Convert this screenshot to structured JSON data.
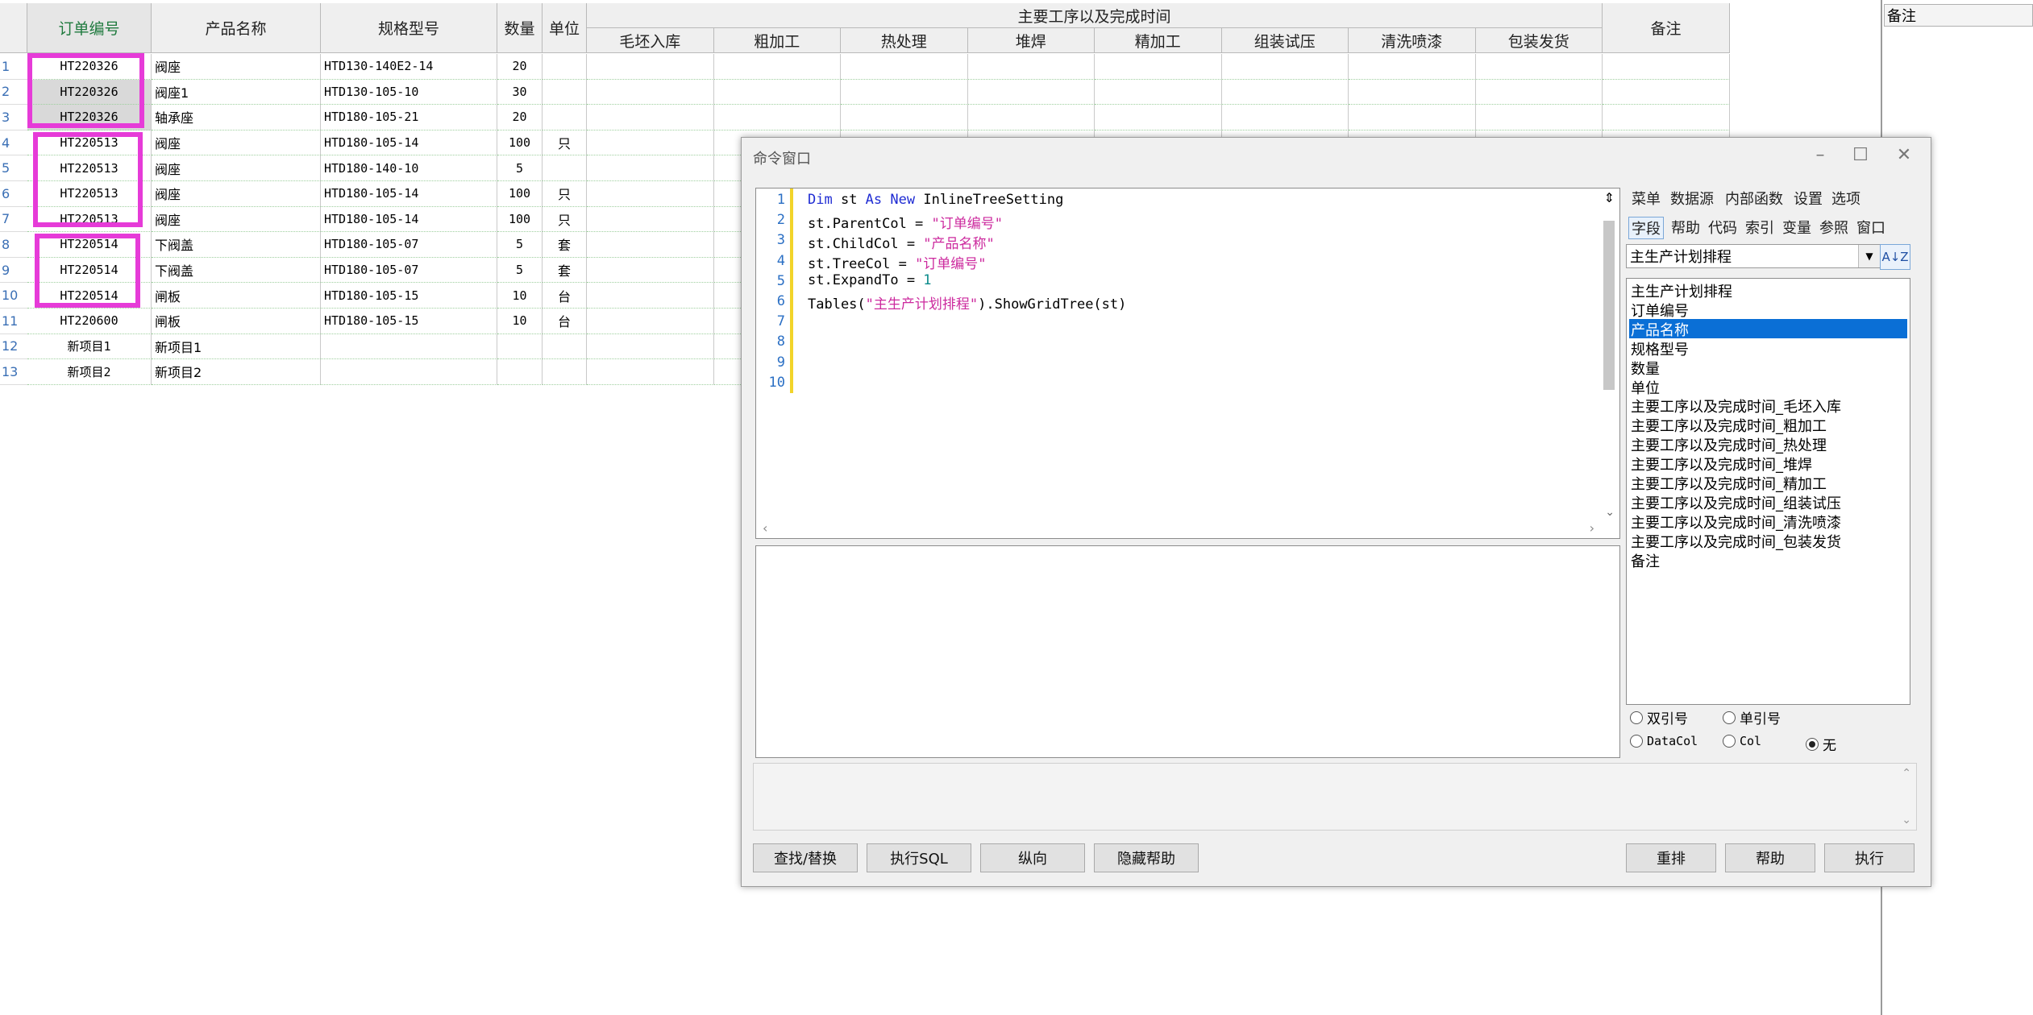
{
  "grid": {
    "headers": {
      "order_no": "订单编号",
      "product_name": "产品名称",
      "spec": "规格型号",
      "qty": "数量",
      "unit": "单位",
      "process_group": "主要工序以及完成时间",
      "remark": "备注"
    },
    "process_cols": [
      "毛坯入库",
      "粗加工",
      "热处理",
      "堆焊",
      "精加工",
      "组装试压",
      "清洗喷漆",
      "包装发货"
    ],
    "rows": [
      {
        "n": "1",
        "order": "HT220326",
        "name": "阀座",
        "spec": "HTD130-140E2-14",
        "qty": "20",
        "unit": ""
      },
      {
        "n": "2",
        "order": "HT220326",
        "name": "阀座1",
        "spec": "HTD130-105-10",
        "qty": "30",
        "unit": ""
      },
      {
        "n": "3",
        "order": "HT220326",
        "name": "轴承座",
        "spec": "HTD180-105-21",
        "qty": "20",
        "unit": ""
      },
      {
        "n": "4",
        "order": "HT220513",
        "name": "阀座",
        "spec": "HTD180-105-14",
        "qty": "100",
        "unit": "只"
      },
      {
        "n": "5",
        "order": "HT220513",
        "name": "阀座",
        "spec": "HTD180-140-10",
        "qty": "5",
        "unit": ""
      },
      {
        "n": "6",
        "order": "HT220513",
        "name": "阀座",
        "spec": "HTD180-105-14",
        "qty": "100",
        "unit": "只"
      },
      {
        "n": "7",
        "order": "HT220513",
        "name": "阀座",
        "spec": "HTD180-105-14",
        "qty": "100",
        "unit": "只"
      },
      {
        "n": "8",
        "order": "HT220514",
        "name": "下阀盖",
        "spec": "HTD180-105-07",
        "qty": "5",
        "unit": "套"
      },
      {
        "n": "9",
        "order": "HT220514",
        "name": "下阀盖",
        "spec": "HTD180-105-07",
        "qty": "5",
        "unit": "套"
      },
      {
        "n": "10",
        "order": "HT220514",
        "name": "闸板",
        "spec": "HTD180-105-15",
        "qty": "10",
        "unit": "台"
      },
      {
        "n": "11",
        "order": "HT220600",
        "name": "闸板",
        "spec": "HTD180-105-15",
        "qty": "10",
        "unit": "台"
      },
      {
        "n": "12",
        "order": "新项目1",
        "name": "新项目1",
        "spec": "",
        "qty": "",
        "unit": ""
      },
      {
        "n": "13",
        "order": "新项目2",
        "name": "新项目2",
        "spec": "",
        "qty": "",
        "unit": ""
      }
    ]
  },
  "right_panel": {
    "header": "备注"
  },
  "command_window": {
    "title": "命令窗口",
    "code_lines": [
      {
        "n": "1"
      },
      {
        "n": "2"
      },
      {
        "n": "3"
      },
      {
        "n": "4"
      },
      {
        "n": "5"
      },
      {
        "n": "6"
      },
      {
        "n": "7"
      },
      {
        "n": "8"
      },
      {
        "n": "9"
      },
      {
        "n": "10"
      }
    ],
    "code": {
      "l1_kw1": "Dim",
      "l1_var": " st ",
      "l1_kw2": "As",
      "l1_sp": " ",
      "l1_kw3": "New",
      "l1_type": " InlineTreeSetting",
      "l2_a": "st.ParentCol = ",
      "l2_s": "\"订单编号\"",
      "l3_a": "st.ChildCol = ",
      "l3_s": "\"产品名称\"",
      "l4_a": "st.TreeCol = ",
      "l4_s": "\"订单编号\"",
      "l5_a": "st.ExpandTo = ",
      "l5_n": "1",
      "l6_a": "Tables(",
      "l6_s": "\"主生产计划排程\"",
      "l6_b": ").ShowGridTree(st)"
    },
    "menu_row1": [
      "菜单",
      "数据源",
      "内部函数",
      "设置",
      "选项"
    ],
    "menu_row2": [
      "字段",
      "帮助",
      "代码",
      "索引",
      "变量",
      "参照",
      "窗口"
    ],
    "table_select": "主生产计划排程",
    "sort_icon_label": "A↓Z",
    "fields": [
      "主生产计划排程",
      "订单编号",
      "产品名称",
      "规格型号",
      "数量",
      "单位",
      "主要工序以及完成时间_毛坯入库",
      "主要工序以及完成时间_粗加工",
      "主要工序以及完成时间_热处理",
      "主要工序以及完成时间_堆焊",
      "主要工序以及完成时间_精加工",
      "主要工序以及完成时间_组装试压",
      "主要工序以及完成时间_清洗喷漆",
      "主要工序以及完成时间_包装发货",
      "备注"
    ],
    "radios": {
      "double": "双引号",
      "single": "单引号",
      "datacol": "DataCol",
      "col": "Col",
      "none": "无"
    },
    "buttons": {
      "find": "查找/替换",
      "sql": "执行SQL",
      "vertical": "纵向",
      "hide_help": "隐藏帮助",
      "reorder": "重排",
      "help": "帮助",
      "run": "执行"
    }
  }
}
